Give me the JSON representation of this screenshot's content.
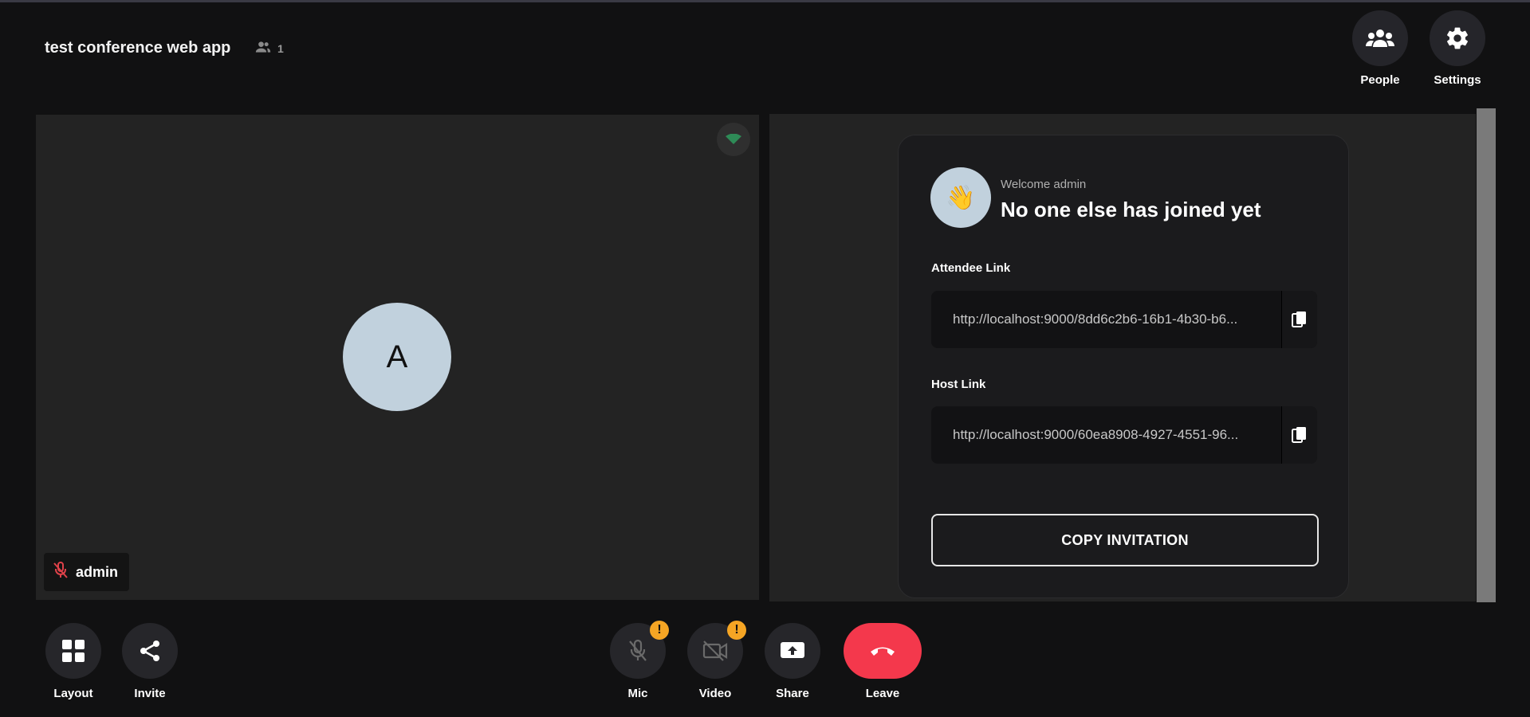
{
  "header": {
    "title": "test conference web app",
    "participant_count": "1",
    "people_label": "People",
    "settings_label": "Settings"
  },
  "tile": {
    "avatar_initial": "A",
    "name": "admin"
  },
  "welcome_card": {
    "greeting": "Welcome admin",
    "heading": "No one else has joined yet",
    "attendee_label": "Attendee Link",
    "attendee_url": "http://localhost:9000/8dd6c2b6-16b1-4b30-b6...",
    "host_label": "Host Link",
    "host_url": "http://localhost:9000/60ea8908-4927-4551-96...",
    "copy_invitation": "COPY INVITATION"
  },
  "toolbar": {
    "layout": "Layout",
    "invite": "Invite",
    "mic": "Mic",
    "video": "Video",
    "share": "Share",
    "leave": "Leave",
    "warning_glyph": "!"
  },
  "colors": {
    "leave": "#f4384c",
    "warning": "#f5a524",
    "avatar": "#c1d1dd",
    "muted_mic": "#e0424a",
    "signal": "#2e8b57"
  }
}
